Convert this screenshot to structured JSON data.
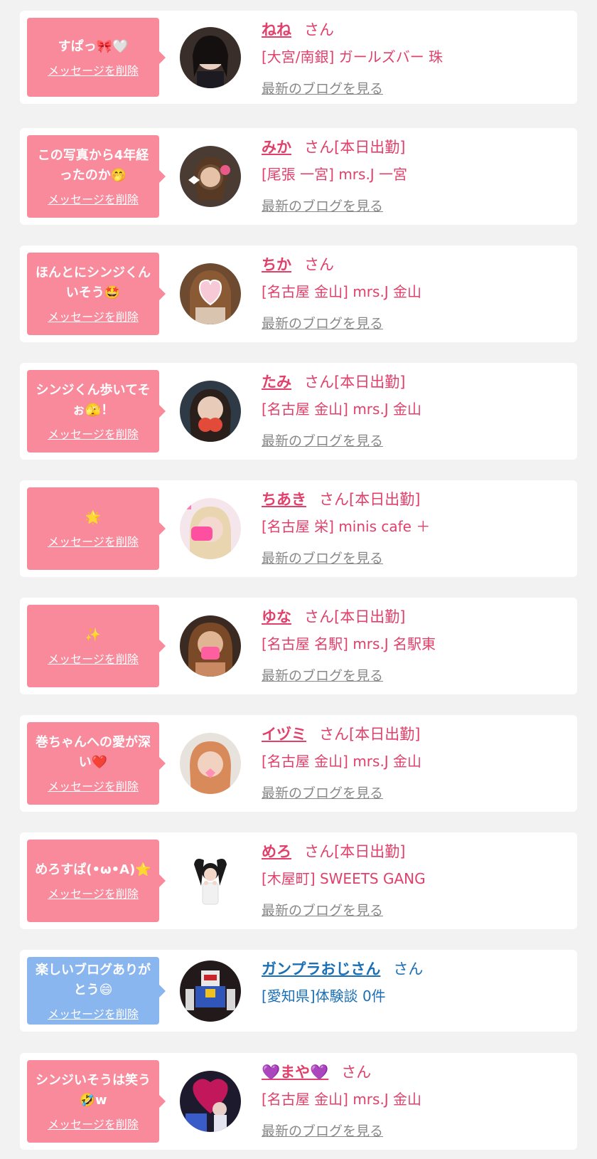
{
  "delete_label": "メッセージを削除",
  "blog_label": "最新のブログを見る",
  "colors": {
    "pink_bubble": "#f88a9c",
    "blue_bubble": "#8ab6ef",
    "name_pink": "#e0406a",
    "name_blue": "#1a6fb5",
    "link_gray": "#888888"
  },
  "items": [
    {
      "message": "すぱっ🎀🤍",
      "name": "ねね",
      "san": "さん",
      "shop": "[大宮/南銀] ガールズバー 珠",
      "bubble": "pink"
    },
    {
      "message": "この写真から4年経ったのか🤭",
      "name": "みか",
      "san": "さん[本日出勤]",
      "shop": "[尾張 一宮] mrs.J 一宮",
      "bubble": "pink"
    },
    {
      "message": "ほんとにシンジくんいそう🤩",
      "name": "ちか",
      "san": "さん",
      "shop": "[名古屋 金山] mrs.J 金山",
      "bubble": "pink"
    },
    {
      "message": "シンジくん歩いてそぉ🫣！",
      "name": "たみ",
      "san": "さん[本日出勤]",
      "shop": "[名古屋 金山] mrs.J 金山",
      "bubble": "pink"
    },
    {
      "message": "🌟",
      "name": "ちあき",
      "san": "さん[本日出勤]",
      "shop": "[名古屋 栄] minis cafe ＋",
      "bubble": "pink"
    },
    {
      "message": "✨",
      "name": "ゆな",
      "san": "さん[本日出勤]",
      "shop": "[名古屋 名駅] mrs.J 名駅東",
      "bubble": "pink"
    },
    {
      "message": "巻ちゃんへの愛が深い❤️",
      "name": "イヅミ",
      "san": "さん[本日出勤]",
      "shop": "[名古屋 金山] mrs.J 金山",
      "bubble": "pink"
    },
    {
      "message": "めろすぱ(•ω•A)⭐",
      "name": "めろ",
      "san": "さん[本日出勤]",
      "shop": "[木屋町] SWEETS GANG",
      "bubble": "pink"
    },
    {
      "message": "楽しいブログありがとう😄",
      "name": "ガンプラおじさん",
      "san": "さん",
      "shop": "[愛知県]体験談 0件",
      "bubble": "blue"
    },
    {
      "message": "シンジいそうは笑う🤣w",
      "name": "💜まや💜",
      "san": "さん",
      "shop": "[名古屋 金山] mrs.J 金山",
      "bubble": "pink"
    }
  ]
}
